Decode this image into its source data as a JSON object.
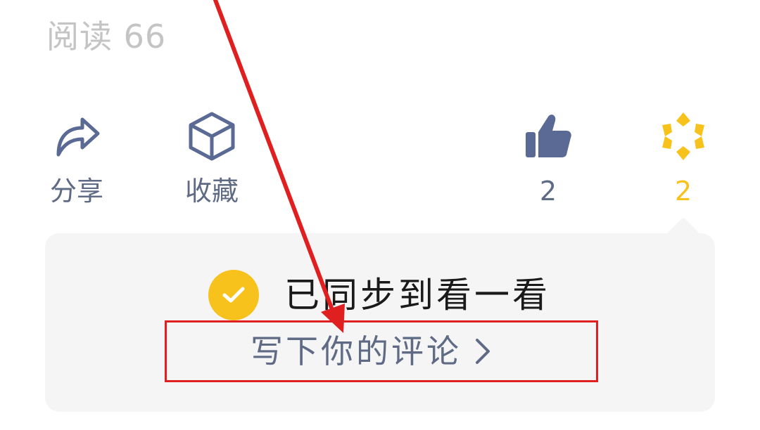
{
  "header": {
    "read_count": "阅读 66"
  },
  "actions": {
    "share": {
      "label": "分享",
      "icon": "share-arrow-icon"
    },
    "favorite": {
      "label": "收藏",
      "icon": "cube-icon"
    },
    "like": {
      "count": "2",
      "icon": "thumbs-up-icon"
    },
    "wow": {
      "count": "2",
      "icon": "star-flower-icon"
    }
  },
  "panel": {
    "synced_text": "已同步到看一看",
    "comment_link": "写下你的评论"
  },
  "colors": {
    "accent_yellow": "#f7c21c",
    "icon_blue": "#5a6a95",
    "annotation_red": "#e02020"
  }
}
